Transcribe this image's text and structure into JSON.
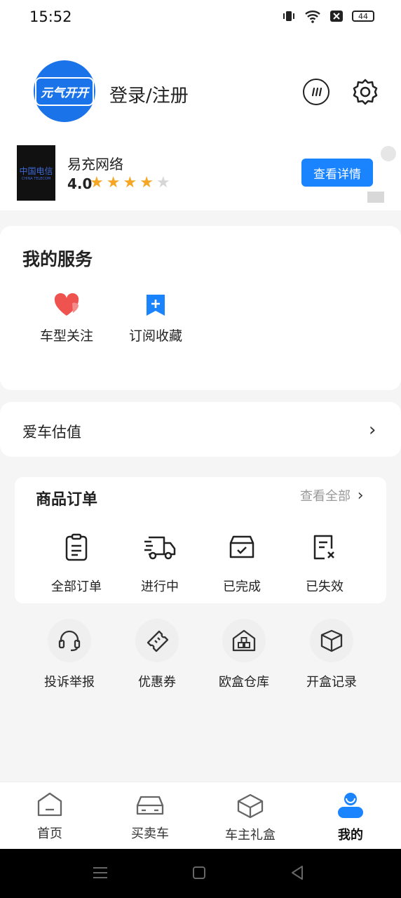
{
  "status": {
    "time": "15:52",
    "battery": "44"
  },
  "header": {
    "logo_text": "元气开开",
    "login_text": "登录/注册"
  },
  "ad": {
    "logo_text": "中国电信",
    "logo_subtext": "CHINA TELECOM",
    "name": "易充网络",
    "rating": "4.0",
    "stars_filled": 4,
    "stars_total": 5,
    "button": "查看详情"
  },
  "services": {
    "title": "我的服务",
    "items": [
      {
        "label": "车型关注",
        "icon": "heart-icon"
      },
      {
        "label": "订阅收藏",
        "icon": "bookmark-plus-icon"
      }
    ]
  },
  "estimate": {
    "label": "爱车估值"
  },
  "orders": {
    "title": "商品订单",
    "view_all": "查看全部",
    "items": [
      {
        "label": "全部订单",
        "icon": "clipboard-icon"
      },
      {
        "label": "进行中",
        "icon": "truck-icon"
      },
      {
        "label": "已完成",
        "icon": "box-check-icon"
      },
      {
        "label": "已失效",
        "icon": "document-x-icon"
      }
    ]
  },
  "tools": [
    {
      "label": "投诉举报",
      "icon": "headset-icon"
    },
    {
      "label": "优惠券",
      "icon": "ticket-icon"
    },
    {
      "label": "欧盒仓库",
      "icon": "warehouse-icon"
    },
    {
      "label": "开盒记录",
      "icon": "package-icon"
    }
  ],
  "tabs": [
    {
      "label": "首页",
      "icon": "home-icon",
      "active": false
    },
    {
      "label": "买卖车",
      "icon": "car-icon",
      "active": false
    },
    {
      "label": "车主礼盒",
      "icon": "giftbox-icon",
      "active": false
    },
    {
      "label": "我的",
      "icon": "user-icon",
      "active": true
    }
  ],
  "colors": {
    "accent": "#1a84ff",
    "star": "#f5a623",
    "heart": "#ef5350"
  }
}
